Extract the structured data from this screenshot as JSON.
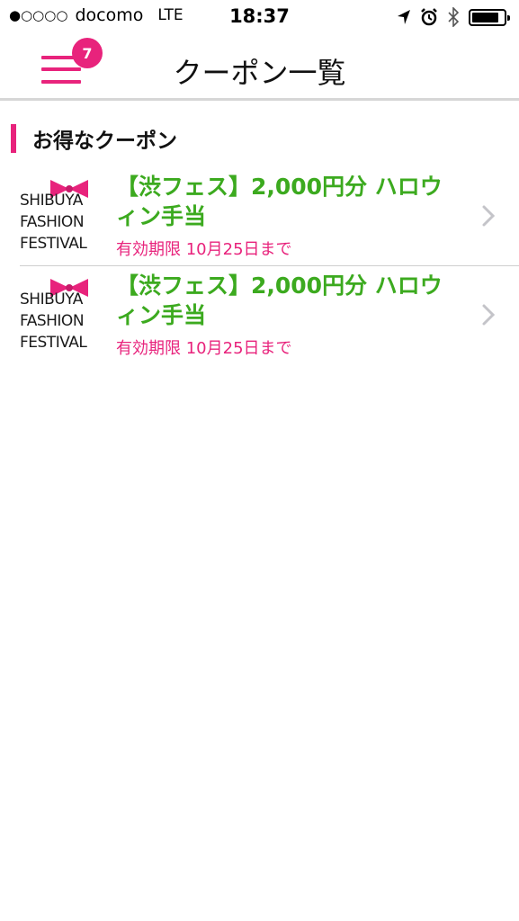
{
  "status_bar": {
    "signal": "●○○○○",
    "carrier": "docomo",
    "network": "LTE",
    "time": "18:37",
    "icons": [
      "location-arrow-icon",
      "alarm-icon",
      "bluetooth-icon",
      "battery-icon"
    ],
    "battery_level": 0.85
  },
  "nav": {
    "title": "クーポン一覧",
    "badge_count": "7",
    "accent_color": "#e8237c"
  },
  "section": {
    "title": "お得なクーポン"
  },
  "coupons": [
    {
      "logo_lines": [
        "SHIBUYA",
        "FASHION",
        "FESTIVAL"
      ],
      "title": "【渋フェス】2,000円分 ハロウィン手当",
      "expiry": "有効期限 10月25日まで"
    },
    {
      "logo_lines": [
        "SHIBUYA",
        "FASHION",
        "FESTIVAL"
      ],
      "title": "【渋フェス】2,000円分 ハロウィン手当",
      "expiry": "有効期限 10月25日まで"
    }
  ],
  "colors": {
    "title_green": "#3caa1f",
    "expiry_pink": "#e8237c"
  }
}
